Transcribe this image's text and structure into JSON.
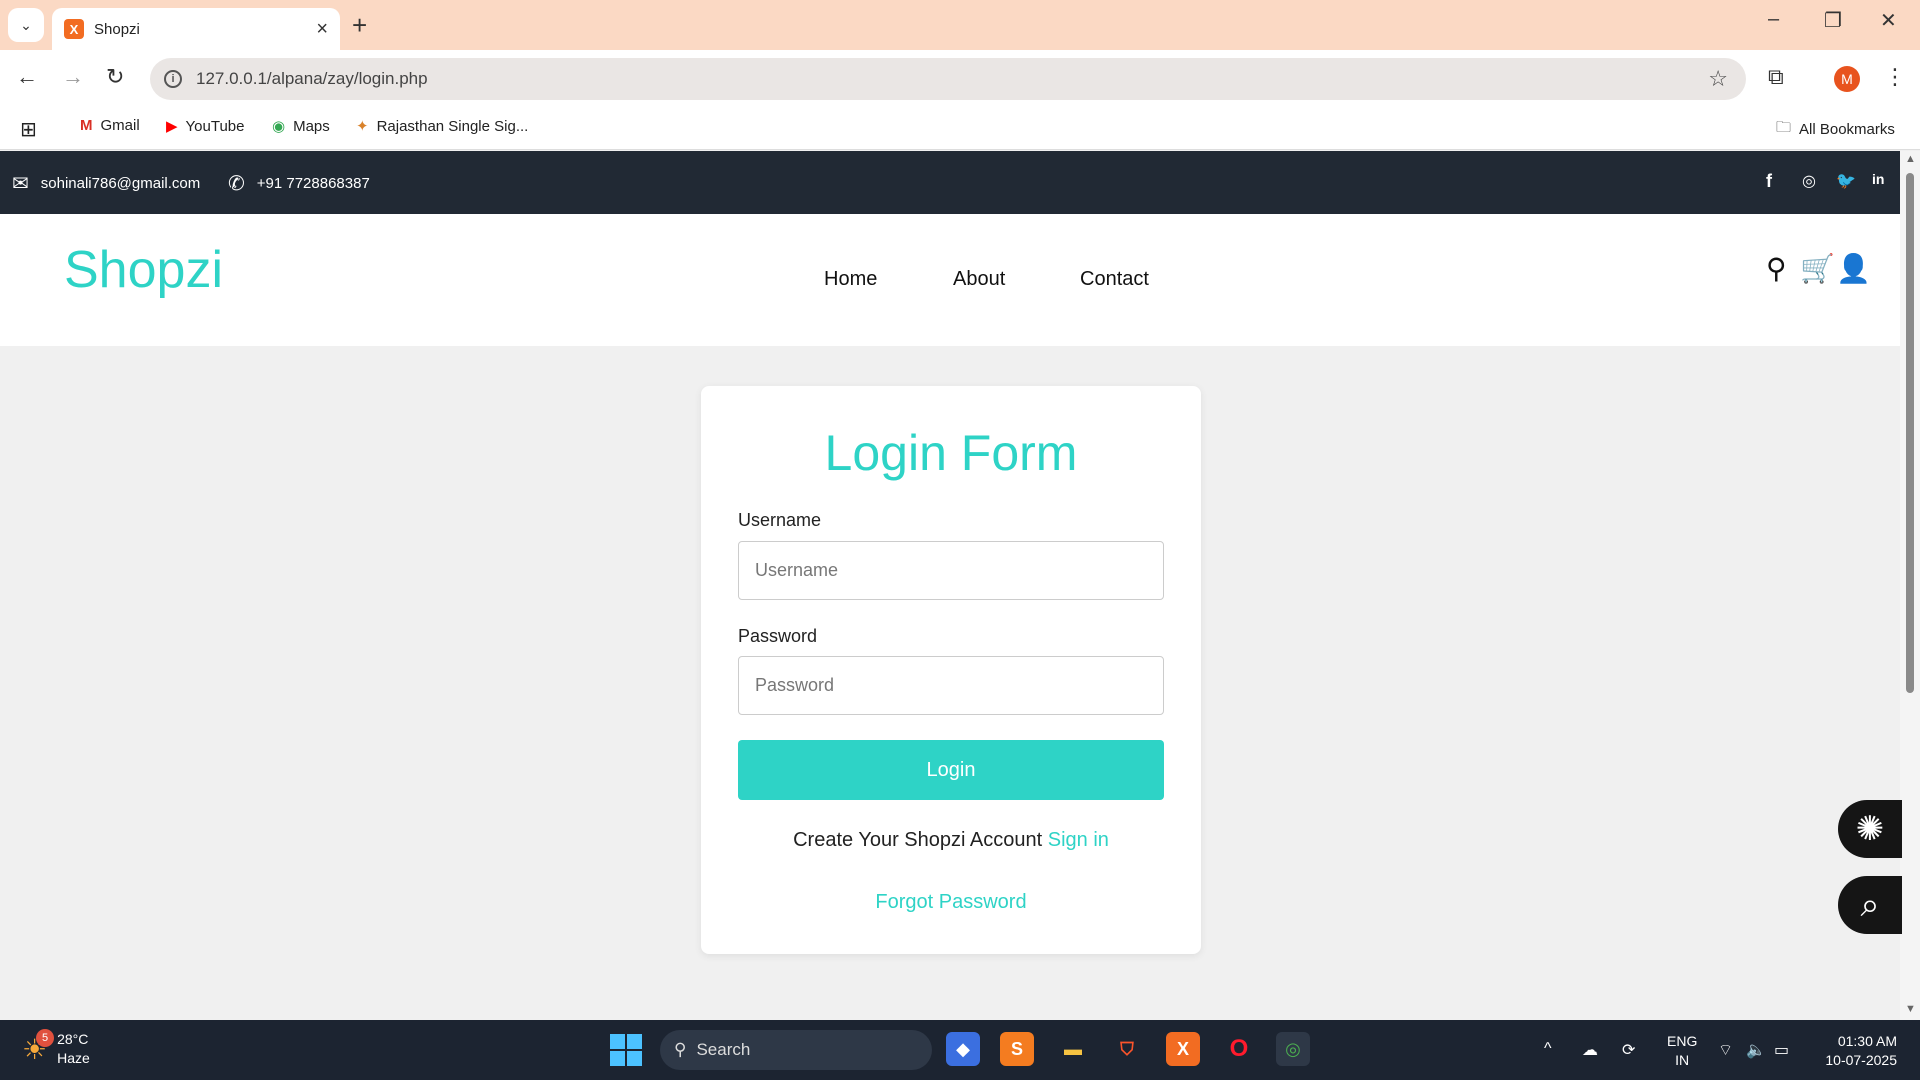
{
  "browser": {
    "tab_title": "Shopzi",
    "tab_favicon": "X",
    "url": "127.0.0.1/alpana/zay/login.php",
    "profile_initial": "M",
    "bookmarks": [
      {
        "label": "Gmail",
        "icon": "M"
      },
      {
        "label": "YouTube",
        "icon": "▶"
      },
      {
        "label": "Maps",
        "icon": "◉"
      },
      {
        "label": "Rajasthan Single Sig...",
        "icon": "✦"
      }
    ],
    "all_bookmarks": "All Bookmarks"
  },
  "topbar": {
    "email": "sohinali786@gmail.com",
    "phone": "+91 7728868387",
    "social": [
      "f",
      "◎",
      "🐦",
      "in"
    ]
  },
  "header": {
    "logo": "Shopzi",
    "nav": [
      "Home",
      "About",
      "Contact"
    ]
  },
  "login": {
    "title": "Login Form",
    "username_label": "Username",
    "username_placeholder": "Username",
    "password_label": "Password",
    "password_placeholder": "Password",
    "button": "Login",
    "create_text": "Create Your Shopzi Account",
    "signin_link": "Sign in",
    "forgot": "Forgot Password"
  },
  "colors": {
    "accent": "#2ed3c6",
    "topbar": "#212934",
    "chrome": "#fbd9c4",
    "taskbar": "#1c2431"
  },
  "taskbar": {
    "weather_temp": "28°C",
    "weather_desc": "Haze",
    "weather_badge": "5",
    "search": "Search",
    "lang": "ENG",
    "region": "IN",
    "time": "01:30 AM",
    "date": "10-07-2025"
  }
}
